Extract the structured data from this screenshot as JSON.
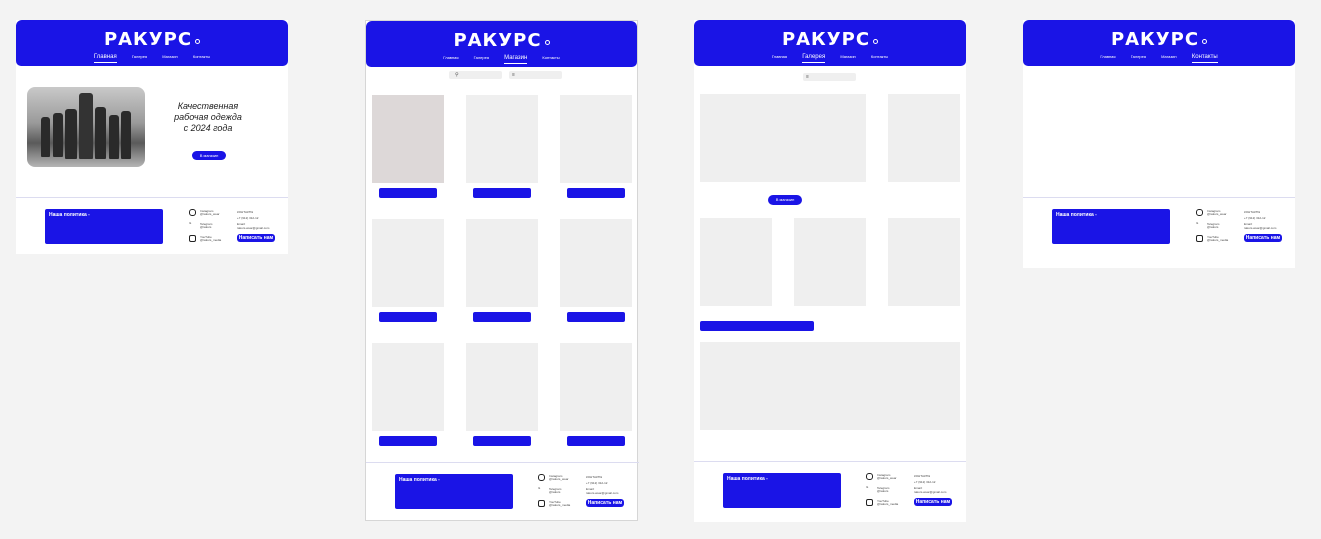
{
  "brand": {
    "logo": "РАКУРС",
    "accent": "#1a14e6"
  },
  "nav_items": [
    "Главная",
    "Галерея",
    "Магазин",
    "Контакты"
  ],
  "pages": {
    "home": {
      "active": "Главная",
      "hero_text_1": "Качественная",
      "hero_text_2": "рабочая одежда",
      "hero_text_3": "с 2024 года",
      "cta": "В магазин"
    },
    "shop": {
      "active": "Магазин",
      "search_icon": "search-icon",
      "filter_icon": "filter-icon"
    },
    "gallery": {
      "active": "Галерея",
      "cta": "В магазин"
    },
    "contacts": {
      "active": "Контакты"
    }
  },
  "footer": {
    "policy": "Наша политика -",
    "instagram_1": "Instagram",
    "instagram_2": "@rakurs_wear",
    "telegram_1": "Telegram",
    "telegram_2": "@rakurs",
    "youtube_1": "YouTube",
    "youtube_2": "@rakurs_media",
    "contacts_title": "КОНТАКТЫ",
    "phone": "+7 (912) 312-12",
    "email_label": "Email:",
    "email": "rakurs.wear@gmail.com",
    "write": "Написать нам"
  }
}
